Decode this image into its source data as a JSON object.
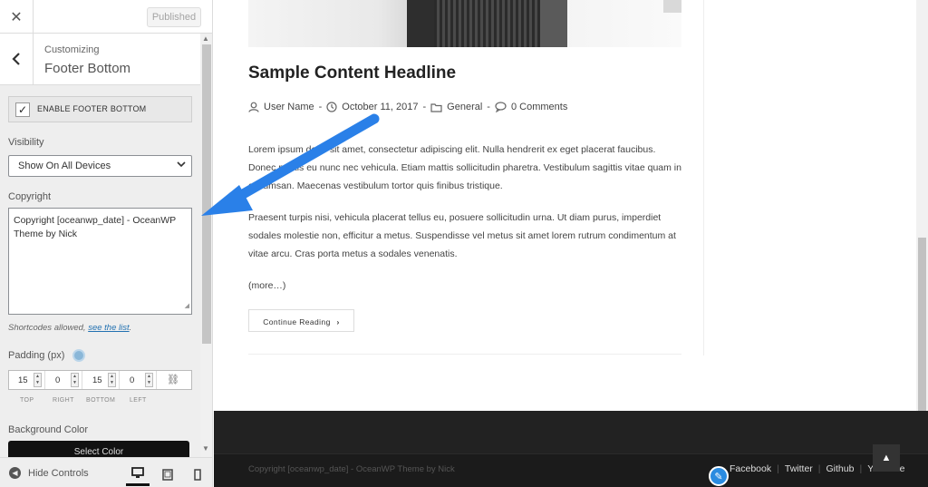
{
  "sidebar": {
    "published_label": "Published",
    "crumb_small": "Customizing",
    "crumb_title": "Footer Bottom",
    "enable_label": "ENABLE FOOTER BOTTOM",
    "enable_checked": true,
    "visibility_label": "Visibility",
    "visibility_value": "Show On All Devices",
    "copyright_label": "Copyright",
    "copyright_value": "Copyright [oceanwp_date] - OceanWP Theme by Nick",
    "shortcodes_note": "Shortcodes allowed,",
    "shortcodes_link": "see the list",
    "shortcodes_end": ".",
    "padding_label": "Padding (px)",
    "padding_values": {
      "top": "15",
      "right": "0",
      "bottom": "15",
      "left": "0"
    },
    "padding_labels": {
      "top": "TOP",
      "right": "RIGHT",
      "bottom": "BOTTOM",
      "left": "LEFT"
    },
    "bgcolor_label": "Background Color",
    "bgcolor_button": "Select Color",
    "hide_controls": "Hide Controls",
    "accent_color": "#2271b1"
  },
  "preview": {
    "post_title": "Sample Content Headline",
    "meta": {
      "author": "User Name",
      "date": "October 11, 2017",
      "category": "General",
      "comments": "0 Comments"
    },
    "para1": "Lorem ipsum dolor sit amet, consectetur adipiscing elit. Nulla hendrerit ex eget placerat faucibus. Donec mattis eu nunc nec vehicula. Etiam mattis sollicitudin pharetra. Vestibulum sagittis vitae quam in accumsan. Maecenas vestibulum tortor quis finibus tristique.",
    "para2": "Praesent turpis nisi, vehicula placerat tellus eu, posuere sollicitudin urna. Ut diam purus, imperdiet sodales molestie non, efficitur a metus. Suspendisse vel metus sit amet lorem rutrum condimentum at vitae arcu. Cras porta metus a sodales venenatis.",
    "more": "(more…)",
    "continue_label": "Continue Reading",
    "footer_copyright": "Copyright [oceanwp_date] - OceanWP Theme by Nick",
    "footer_menu": [
      "Facebook",
      "Twitter",
      "Github",
      "YouTube"
    ],
    "footer_bg": "#222222",
    "arrow_color": "#2a80e8"
  }
}
